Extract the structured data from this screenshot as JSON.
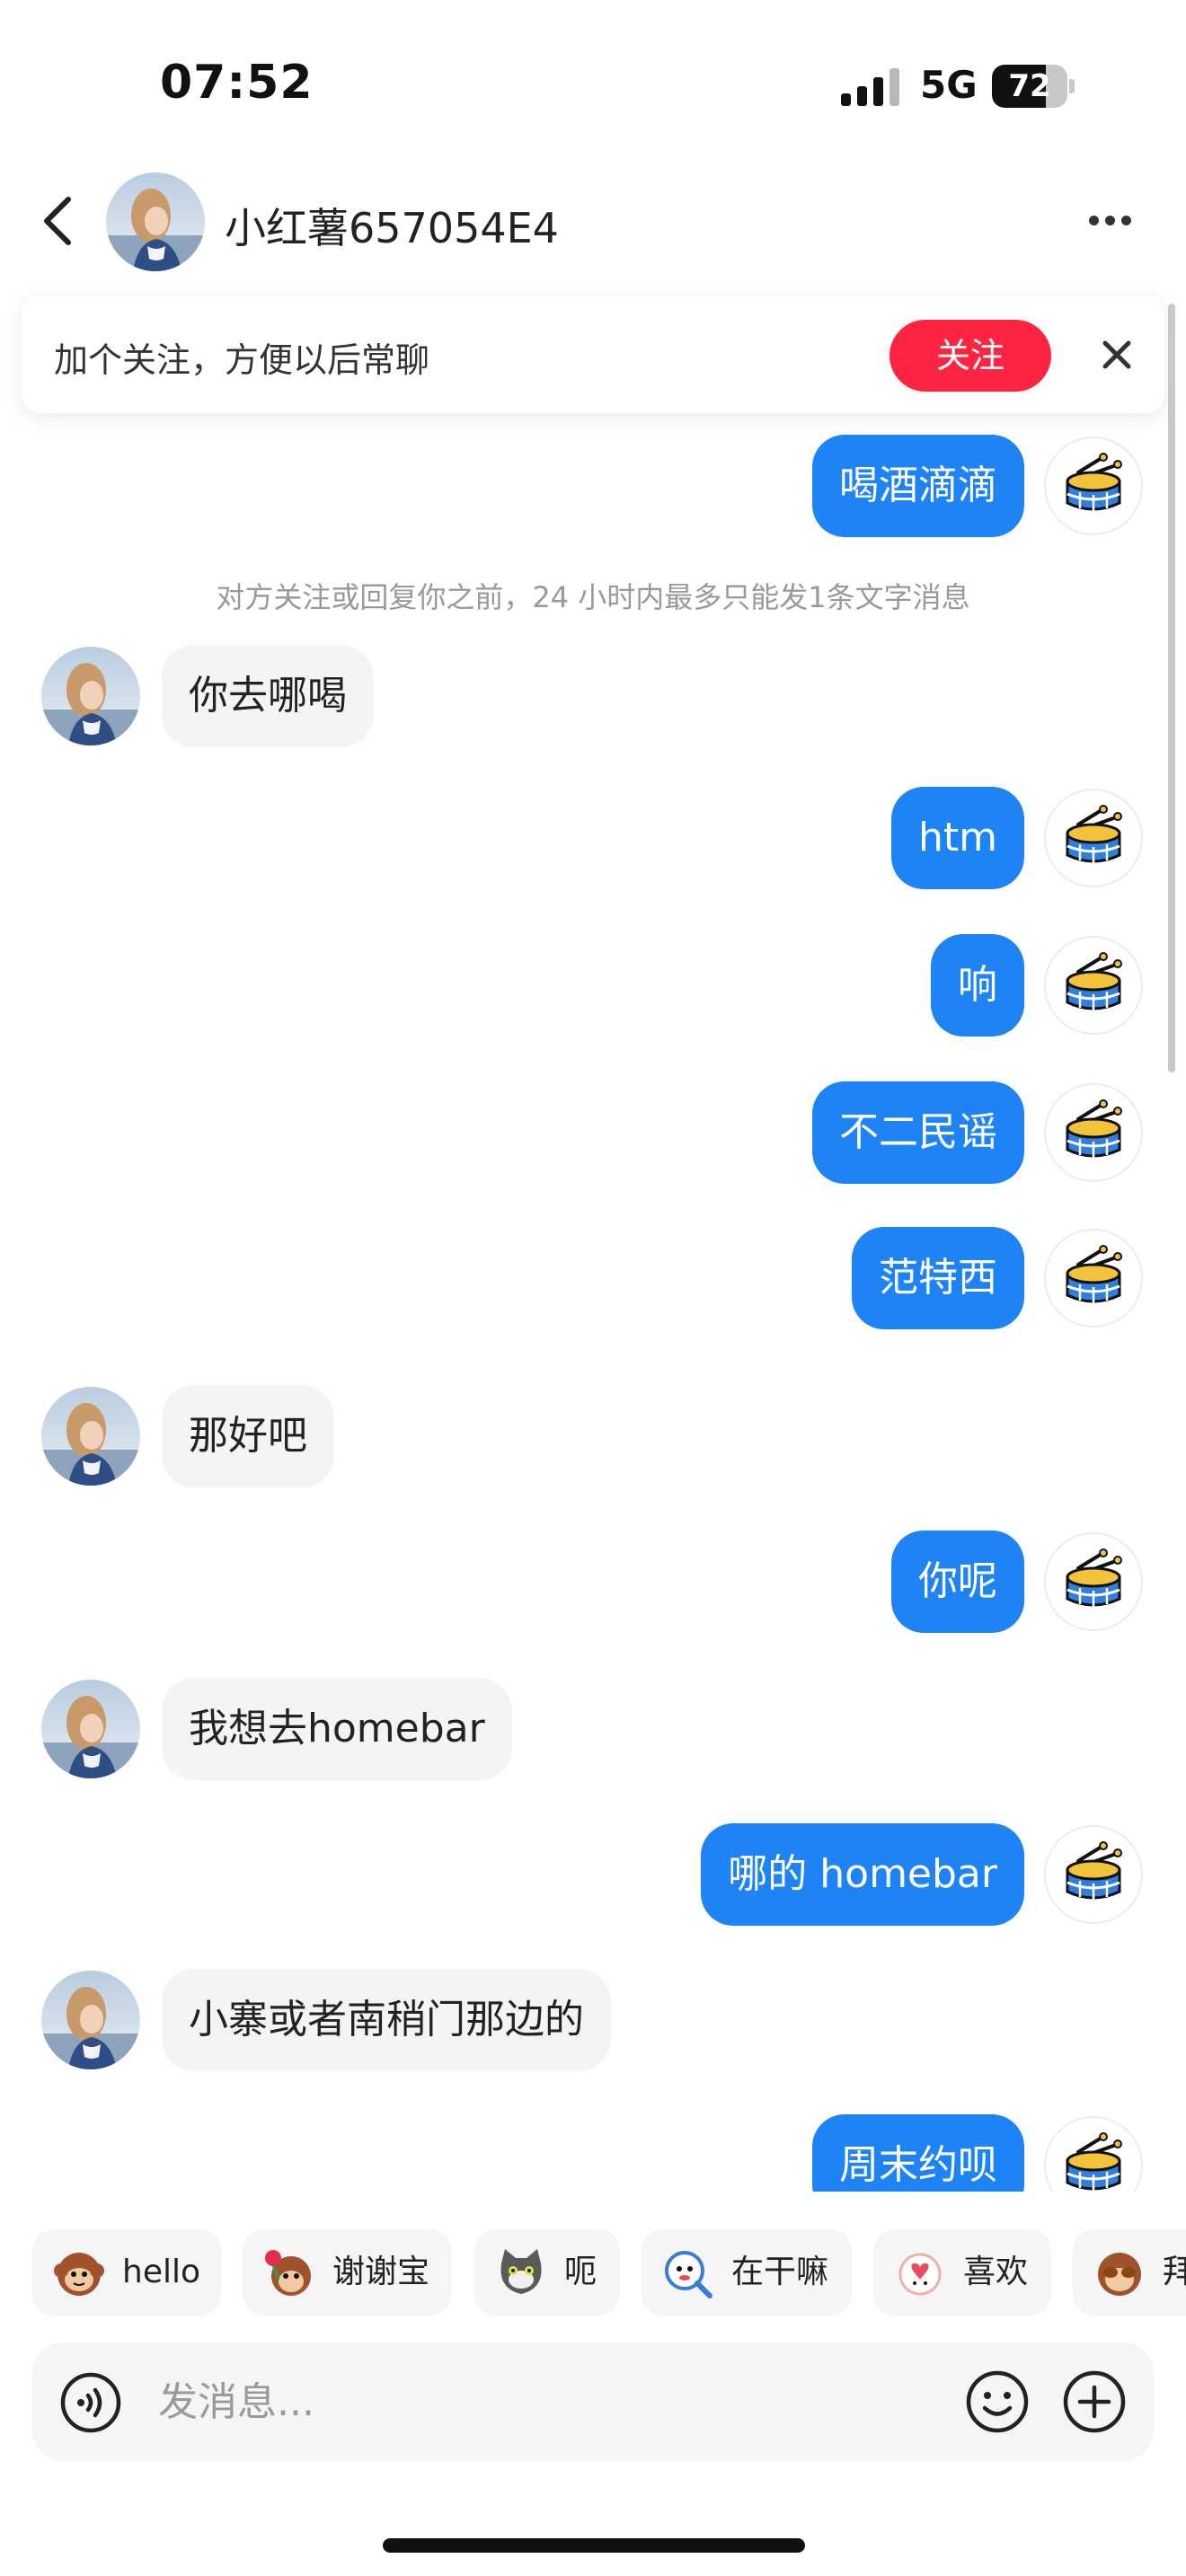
{
  "status_bar": {
    "time": "07:52",
    "network": "5G",
    "battery_level": "72",
    "battery_fraction": 0.72
  },
  "header": {
    "back_icon": "chevron-left-icon",
    "title": "小红薯657054E4",
    "more_icon": "more-dots-icon"
  },
  "follow_banner": {
    "text": "加个关注，方便以后常聊",
    "button_label": "关注",
    "close_icon": "close-icon",
    "accent_color": "#ff2442"
  },
  "chat": {
    "notice": "对方关注或回复你之前，24 小时内最多只能发1条文字消息",
    "outgoing_color": "#1e84f6",
    "incoming_color": "#f4f4f4",
    "messages": [
      {
        "from": "me",
        "text": "喝酒滴滴"
      },
      {
        "from": "them",
        "text": "你去哪喝"
      },
      {
        "from": "me",
        "text": "htm"
      },
      {
        "from": "me",
        "text": "响"
      },
      {
        "from": "me",
        "text": "不二民谣"
      },
      {
        "from": "me",
        "text": "范特西"
      },
      {
        "from": "them",
        "text": "那好吧"
      },
      {
        "from": "me",
        "text": "你呢"
      },
      {
        "from": "them",
        "text": "我想去homebar"
      },
      {
        "from": "me",
        "text": "哪的 homebar"
      },
      {
        "from": "them",
        "text": "小寨或者南稍门那边的"
      },
      {
        "from": "me",
        "text": "周末约呗"
      }
    ]
  },
  "quick_replies": [
    {
      "label": "hello",
      "icon": "monkey-sticker-icon"
    },
    {
      "label": "谢谢宝",
      "icon": "monkey-rose-sticker-icon"
    },
    {
      "label": "呃",
      "icon": "cat-sticker-icon"
    },
    {
      "label": "在干嘛",
      "icon": "magnifier-sticker-icon"
    },
    {
      "label": "喜欢",
      "icon": "heart-sticker-icon"
    },
    {
      "label": "拜",
      "icon": "monkey-bye-sticker-icon"
    }
  ],
  "input": {
    "placeholder": "发消息...",
    "voice_icon": "voice-icon",
    "emoji_icon": "smiley-icon",
    "plus_icon": "plus-circle-icon"
  }
}
